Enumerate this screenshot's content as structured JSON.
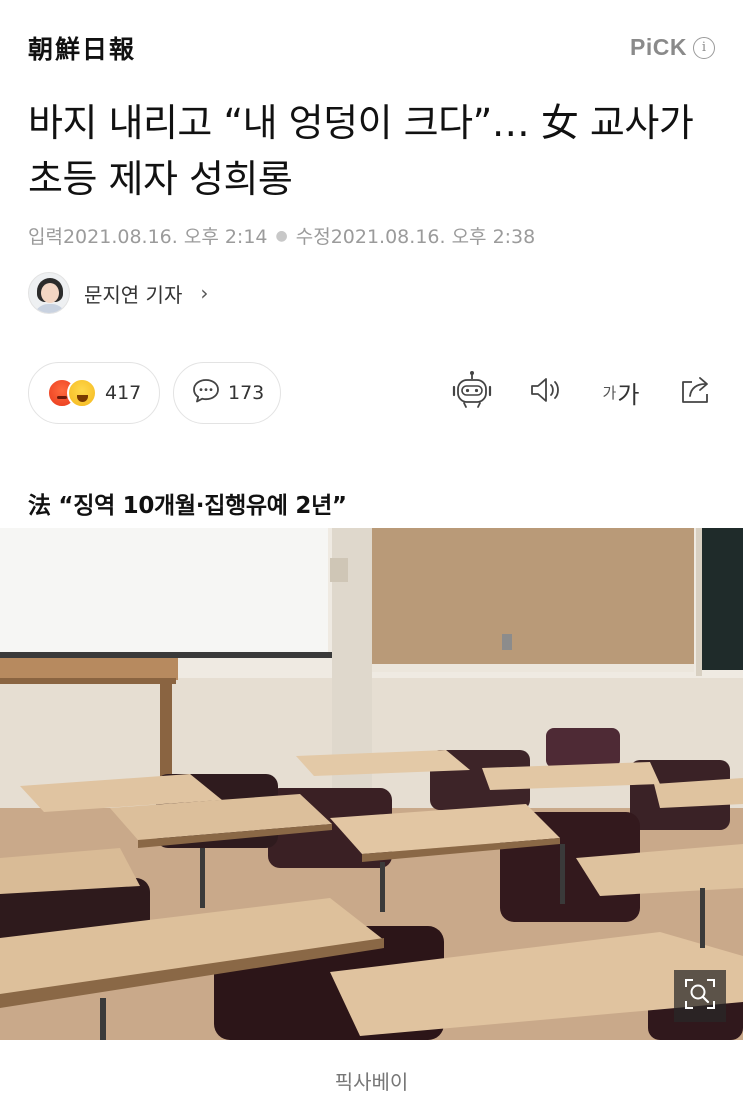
{
  "header": {
    "logo": "朝鮮日報",
    "pick_label": "PiCK",
    "info_glyph": "i"
  },
  "article": {
    "headline": "바지 내리고 “내 엉덩이 크다”… 女 교사가 초등 제자 성희롱",
    "published_label": "입력",
    "published": "2021.08.16. 오후 2:14",
    "modified_label": "수정",
    "modified": "2021.08.16. 오후 2:38",
    "author": "문지연 기자",
    "author_chevron": "›",
    "subheadline": "法 “징역 10개월·집행유예 2년”",
    "photo_caption": "픽사베이"
  },
  "actions": {
    "reaction_count": "417",
    "comment_count": "173",
    "font_small": "가",
    "font_big": "가",
    "icons": [
      "angry-emoji",
      "laugh-emoji",
      "comment-bubble-icon",
      "robot-summary-icon",
      "audio-speaker-icon",
      "font-size-icon",
      "share-icon",
      "zoom-icon"
    ]
  },
  "colors": {
    "meta_text": "#9b9b9b",
    "pick_gray": "#8a8a8a",
    "pill_border": "#e3e3e3",
    "reaction_angry": "#e8391d",
    "reaction_laugh": "#f4b81f"
  }
}
